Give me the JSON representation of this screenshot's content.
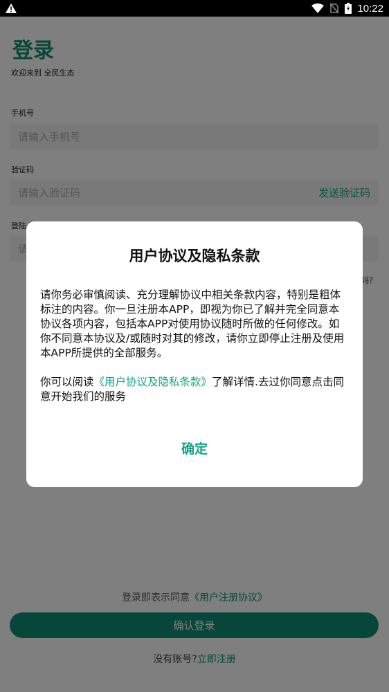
{
  "status_bar": {
    "time": "10:22",
    "icons": [
      "warning-icon",
      "wifi-icon",
      "no-sim-icon",
      "battery-icon"
    ]
  },
  "login": {
    "title": "登录",
    "subtitle": "欢迎来到 全民生态",
    "phone": {
      "label": "手机号",
      "placeholder": "请输入手机号"
    },
    "code": {
      "label": "验证码",
      "placeholder": "请输入验证码",
      "send_label": "发送验证码"
    },
    "password": {
      "label": "登陆",
      "placeholder": "请"
    },
    "forgot_label": "码？",
    "agree_prefix": "登录即表示同意",
    "agree_link": "《用户注册协议》",
    "submit_label": "确认登录",
    "register_prefix": "没有账号?",
    "register_link": "立即注册"
  },
  "dialog": {
    "title": "用户协议及隐私条款",
    "paragraph1": "请你务必审慎阅读、充分理解协议中相关条款内容，特别是粗体标注的内容。你一旦注册本APP，即视为你已了解并完全同意本协议各项内容，包括本APP对使用协议随时所做的任何修改。如你不同意本协议及/或随时对其的修改，请你立即停止注册及使用本APP所提供的全部服务。",
    "paragraph2_prefix": "你可以阅读",
    "paragraph2_link": "《用户协议及隐私条款》",
    "paragraph2_suffix": "了解详情.去过你同意点击同意开始我们的服务",
    "confirm_label": "确定"
  },
  "colors": {
    "brand": "#0f8f74",
    "link": "#11a487"
  }
}
